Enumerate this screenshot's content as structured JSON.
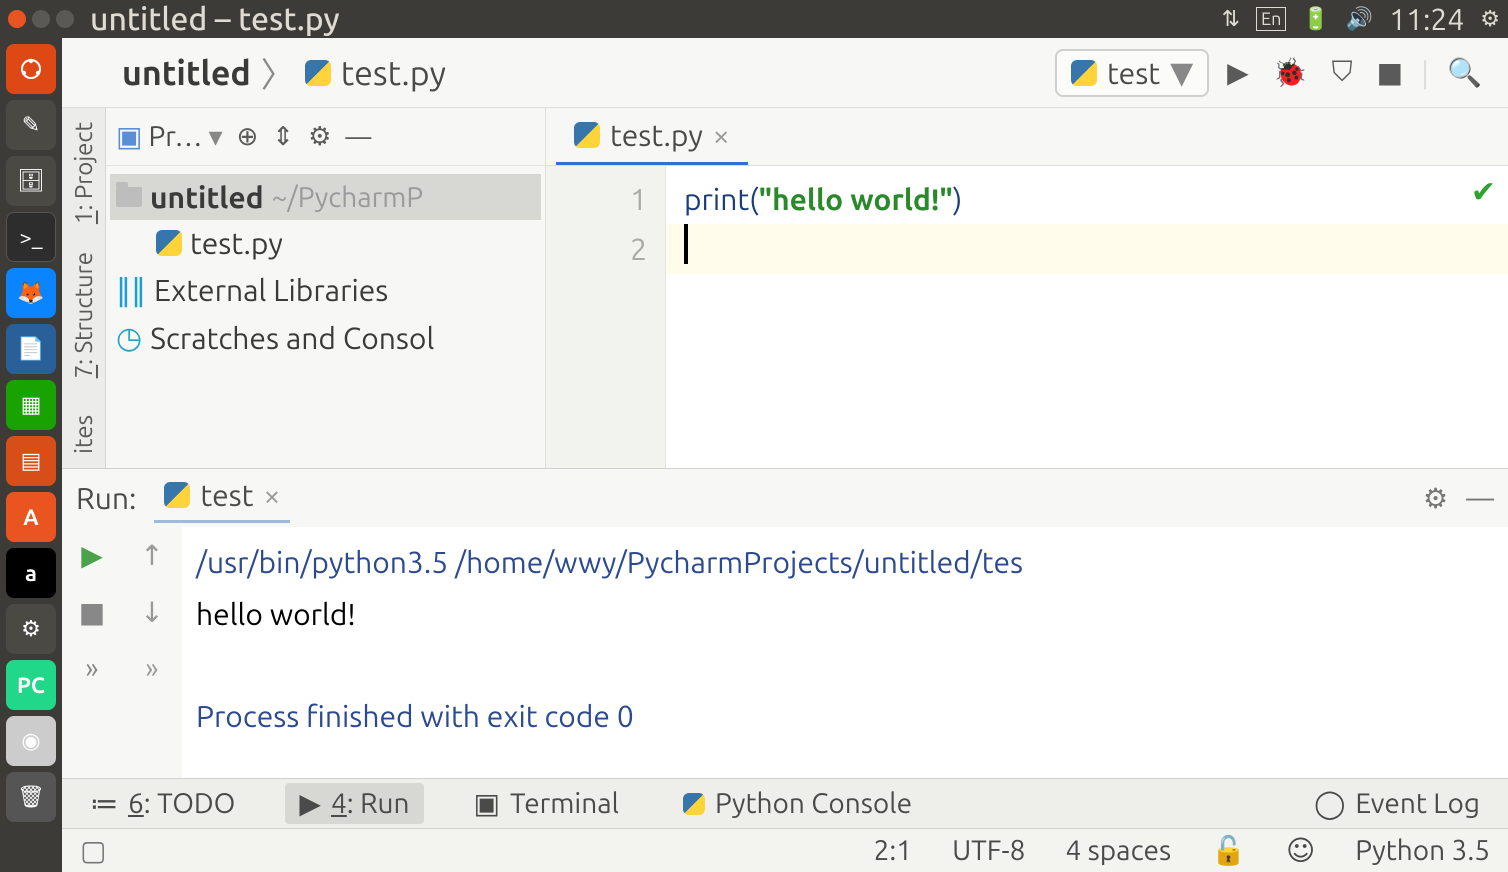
{
  "system": {
    "window_title": "untitled – test.py",
    "clock": "11:24",
    "lang_indicator": "En"
  },
  "launcher_items": [
    {
      "name": "dash",
      "glyph": "◌"
    },
    {
      "name": "text-editor",
      "glyph": "✎"
    },
    {
      "name": "files",
      "glyph": "🗂"
    },
    {
      "name": "terminal",
      "glyph": ">_"
    },
    {
      "name": "firefox",
      "glyph": "🦊"
    },
    {
      "name": "libreoffice-writer",
      "glyph": "📄"
    },
    {
      "name": "libreoffice-calc",
      "glyph": "▦"
    },
    {
      "name": "libreoffice-impress",
      "glyph": "▤"
    },
    {
      "name": "ubuntu-software",
      "glyph": "A"
    },
    {
      "name": "amazon",
      "glyph": "a"
    },
    {
      "name": "settings",
      "glyph": "⚙"
    },
    {
      "name": "pycharm",
      "glyph": "PC"
    },
    {
      "name": "disc",
      "glyph": "◉"
    },
    {
      "name": "trash",
      "glyph": "🗑"
    }
  ],
  "breadcrumb": {
    "project": "untitled",
    "file": "test.py"
  },
  "run_config": {
    "name": "test"
  },
  "left_toolwindows": {
    "project": "1: Project",
    "structure": "7: Structure",
    "favorites": "ites"
  },
  "project_tool": {
    "label": "Pr…"
  },
  "project_tree": {
    "root": {
      "name": "untitled",
      "path": "~/PycharmP"
    },
    "file": "test.py",
    "external_libs": "External Libraries",
    "scratches": "Scratches and Consol"
  },
  "editor": {
    "tab": "test.py",
    "line_numbers": [
      "1",
      "2"
    ],
    "code_line1_prefix": "print(",
    "code_line1_string": "\"hello world!\"",
    "code_line1_suffix": ")"
  },
  "run_panel": {
    "title": "Run:",
    "tab": "test",
    "output_cmd": "/usr/bin/python3.5 /home/wwy/PycharmProjects/untitled/tes",
    "output_text": "hello world!",
    "output_exit": "Process finished with exit code 0"
  },
  "bottom_toolwindows": {
    "todo": "6: TODO",
    "run": "4: Run",
    "terminal": "Terminal",
    "python_console": "Python Console",
    "event_log": "Event Log"
  },
  "status": {
    "caret": "2:1",
    "encoding": "UTF-8",
    "indent": "4 spaces",
    "interpreter": "Python 3.5"
  }
}
